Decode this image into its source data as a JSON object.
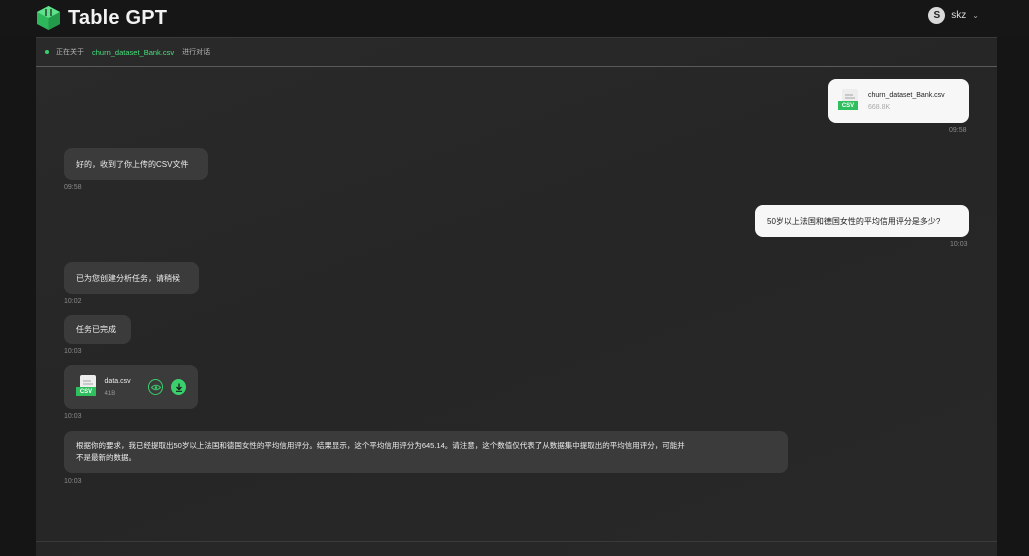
{
  "app": {
    "name": "Table GPT",
    "brand_color": "#3ad06b"
  },
  "user": {
    "initial": "S",
    "name": "skz"
  },
  "context": {
    "prefix": "正在关于",
    "file": "churn_dataset_Bank.csv",
    "suffix": "进行对话"
  },
  "messages": {
    "upload": {
      "file_name": "churn_dataset_Bank.csv",
      "size": "668.8K",
      "time": "09:58",
      "tag": "CSV"
    },
    "ack": {
      "text": "好的，收到了你上传的CSV文件",
      "time": "09:58"
    },
    "question": {
      "text": "50岁以上法国和德国女性的平均信用评分是多少?",
      "time": "10:03"
    },
    "task_created": {
      "text": "已为您创建分析任务，请稍候",
      "time": "10:02"
    },
    "task_done": {
      "text": "任务已完成",
      "time": "10:03"
    },
    "result_file": {
      "file_name": "data.csv",
      "size": "41B",
      "time": "10:03",
      "tag": "CSV"
    },
    "answer": {
      "line1": "根据你的要求，我已经提取出50岁以上法国和德国女性的平均信用评分。结果显示，这个平均信用评分为645.14。请注意，这个数值仅代表了从数据集中提取出的平均信用评分，可能并",
      "line2": "不是最新的数据。",
      "time": "10:03"
    }
  }
}
